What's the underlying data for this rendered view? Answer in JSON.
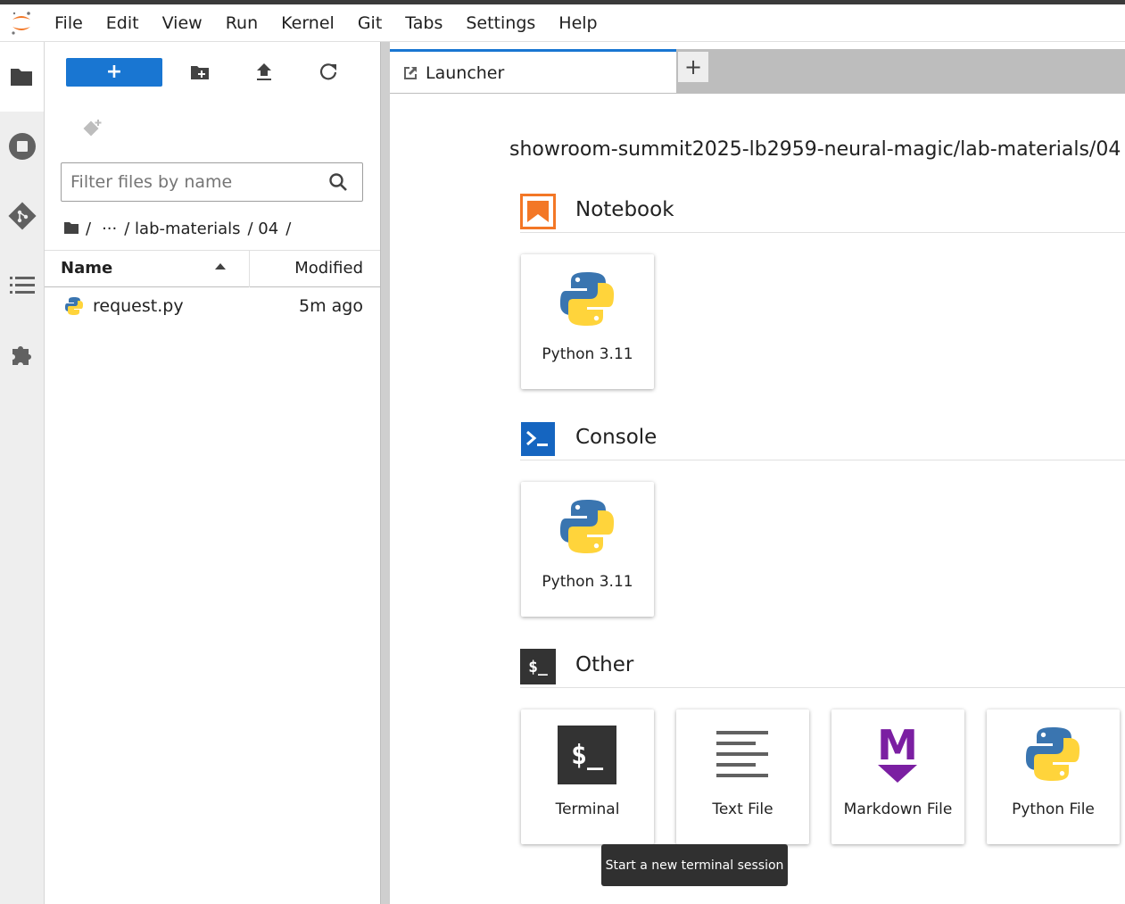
{
  "menubar": {
    "items": [
      "File",
      "Edit",
      "View",
      "Run",
      "Kernel",
      "Git",
      "Tabs",
      "Settings",
      "Help"
    ]
  },
  "activity_bar": {
    "icons": [
      "folder-icon",
      "stop-circle-icon",
      "git-icon",
      "list-icon",
      "puzzle-icon"
    ]
  },
  "file_browser": {
    "new_label": "+",
    "filter_placeholder": "Filter files by name",
    "breadcrumb": [
      "/",
      "···",
      "/ lab-materials",
      "/ 04",
      "/"
    ],
    "columns": {
      "name": "Name",
      "modified": "Modified"
    },
    "files": [
      {
        "name": "request.py",
        "modified": "5m ago"
      }
    ]
  },
  "tabs": {
    "active_label": "Launcher",
    "add_label": "+"
  },
  "launcher": {
    "path": "showroom-summit2025-lb2959-neural-magic/lab-materials/04",
    "sections": [
      {
        "title": "Notebook",
        "cards": [
          "Python 3.11"
        ]
      },
      {
        "title": "Console",
        "cards": [
          "Python 3.11"
        ]
      },
      {
        "title": "Other",
        "cards": [
          "Terminal",
          "Text File",
          "Markdown File",
          "Python File"
        ]
      }
    ],
    "terminal_glyph": "$_",
    "markdown_glyph": "M"
  },
  "tooltip": "Start a new terminal session",
  "colors": {
    "accent": "#1976d2",
    "notebook_orange": "#f37726",
    "console_blue": "#0d47a1",
    "markdown_purple": "#7b1fa2",
    "python_blue": "#3a75b0",
    "python_yellow": "#ffd43b"
  }
}
